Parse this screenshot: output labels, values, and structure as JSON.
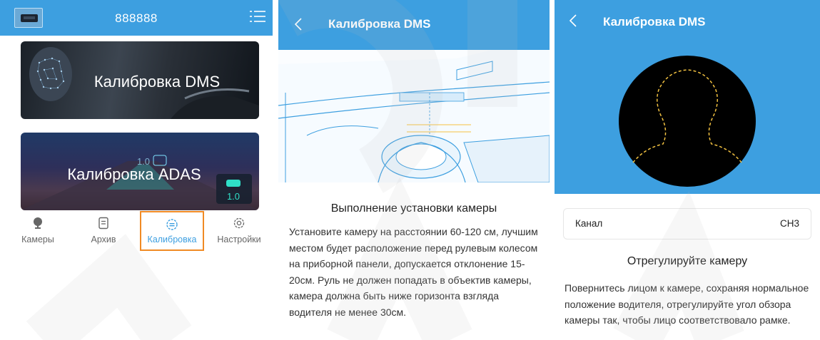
{
  "colors": {
    "accent": "#3d9fe0",
    "active_outline": "#f08a24",
    "text": "#333333"
  },
  "screen1": {
    "device_title": "888888",
    "icons": {
      "device": "dvr-device-icon",
      "menu": "list-menu-icon"
    },
    "cards": [
      {
        "label": "Калибровка DMS"
      },
      {
        "label": "Калибровка ADAS",
        "badge": "1.0"
      }
    ],
    "tabs": [
      {
        "label": "Камеры",
        "icon": "camera-pin-icon",
        "active": false
      },
      {
        "label": "Архив",
        "icon": "archive-icon",
        "active": false
      },
      {
        "label": "Калибровка",
        "icon": "calibration-icon",
        "active": true
      },
      {
        "label": "Настройки",
        "icon": "settings-gear-icon",
        "active": false
      }
    ]
  },
  "screen2": {
    "title": "Калибровка DMS",
    "heading": "Выполнение установки камеры",
    "body": "Установите камеру на расстоянии 60-120 см, лучшим местом будет расположение перед рулевым колесом на приборной панели, допускается отклонение 15-20см. Руль не должен попадать в объектив камеры, камера должна быть ниже горизонта взгляда водителя не менее 30см."
  },
  "screen3": {
    "title": "Калибровка DMS",
    "channel_label": "Канал",
    "channel_value": "CH3",
    "heading": "Отрегулируйте камеру",
    "body": "Повернитесь лицом к камере, сохраняя нормальное положение водителя, отрегулируйте угол обзора камеры так, чтобы лицо соответствовало рамке."
  }
}
